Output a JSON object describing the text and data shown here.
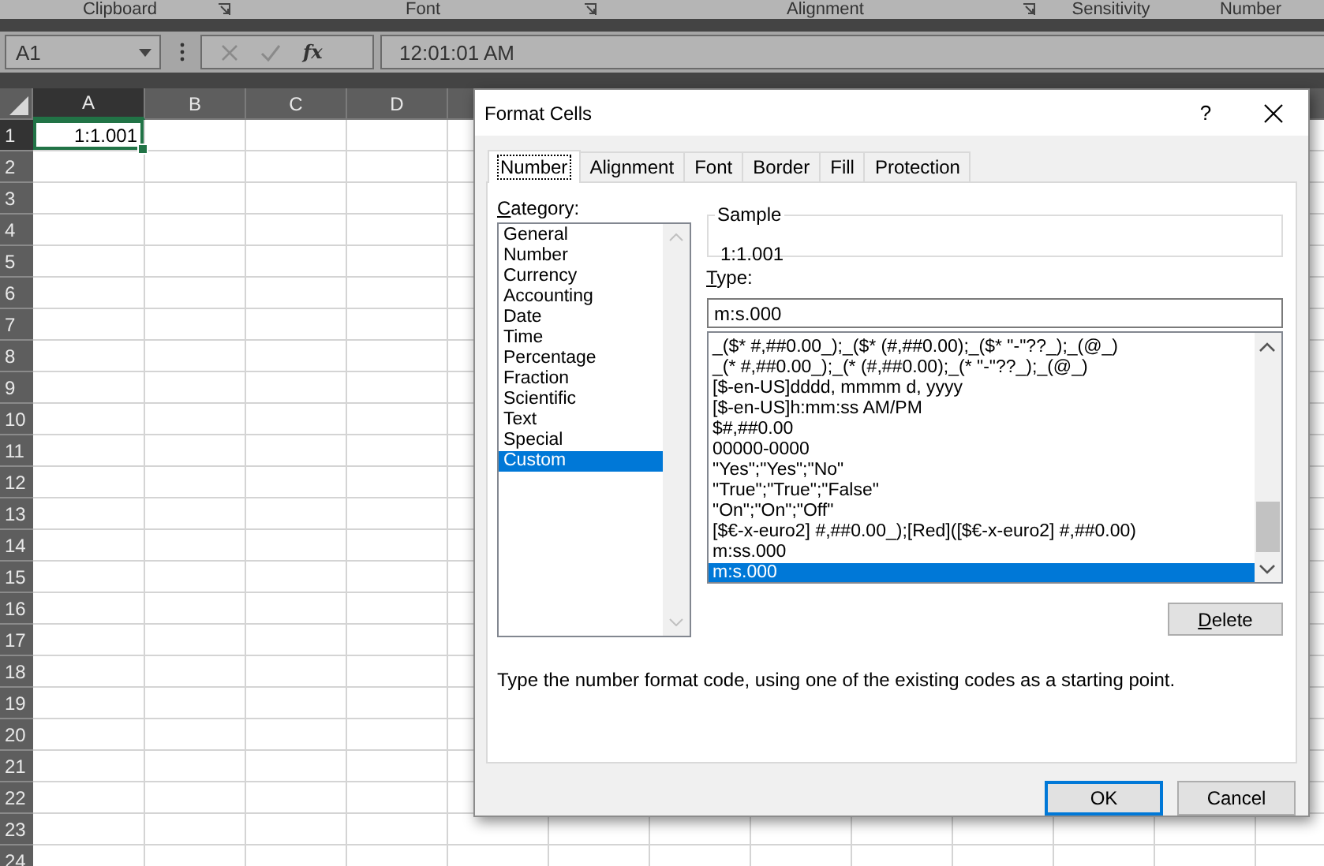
{
  "ribbon": {
    "groups": [
      {
        "label": "Clipboard",
        "launcher": true
      },
      {
        "label": "Font",
        "launcher": true
      },
      {
        "label": "Alignment",
        "launcher": true
      },
      {
        "label": "Sensitivity",
        "launcher": false
      },
      {
        "label": "Number",
        "launcher": false
      }
    ]
  },
  "formula_bar": {
    "name_box": "A1",
    "function_label": "fx",
    "formula": "12:01:01 AM"
  },
  "sheet": {
    "columns": [
      {
        "label": "A",
        "selected": true
      },
      {
        "label": "B",
        "selected": false
      },
      {
        "label": "C",
        "selected": false
      },
      {
        "label": "D",
        "selected": false
      }
    ],
    "rows": [
      {
        "label": "1",
        "selected": true
      },
      {
        "label": "2",
        "selected": false
      },
      {
        "label": "3",
        "selected": false
      },
      {
        "label": "4",
        "selected": false
      },
      {
        "label": "5",
        "selected": false
      },
      {
        "label": "6",
        "selected": false
      },
      {
        "label": "7",
        "selected": false
      },
      {
        "label": "8",
        "selected": false
      },
      {
        "label": "9",
        "selected": false
      },
      {
        "label": "10",
        "selected": false
      },
      {
        "label": "11",
        "selected": false
      },
      {
        "label": "12",
        "selected": false
      },
      {
        "label": "13",
        "selected": false
      },
      {
        "label": "14",
        "selected": false
      },
      {
        "label": "15",
        "selected": false
      },
      {
        "label": "16",
        "selected": false
      },
      {
        "label": "17",
        "selected": false
      },
      {
        "label": "18",
        "selected": false
      },
      {
        "label": "19",
        "selected": false
      },
      {
        "label": "20",
        "selected": false
      },
      {
        "label": "21",
        "selected": false
      },
      {
        "label": "22",
        "selected": false
      },
      {
        "label": "23",
        "selected": false
      },
      {
        "label": "24",
        "selected": false
      }
    ],
    "active_cell_value": "1:1.001"
  },
  "dialog": {
    "title": "Format Cells",
    "help": "?",
    "tabs": [
      {
        "label": "Number",
        "selected": true
      },
      {
        "label": "Alignment",
        "selected": false
      },
      {
        "label": "Font",
        "selected": false
      },
      {
        "label": "Border",
        "selected": false
      },
      {
        "label": "Fill",
        "selected": false
      },
      {
        "label": "Protection",
        "selected": false
      }
    ],
    "category": {
      "label": "Category:",
      "items": [
        {
          "label": "General",
          "selected": false
        },
        {
          "label": "Number",
          "selected": false
        },
        {
          "label": "Currency",
          "selected": false
        },
        {
          "label": "Accounting",
          "selected": false
        },
        {
          "label": "Date",
          "selected": false
        },
        {
          "label": "Time",
          "selected": false
        },
        {
          "label": "Percentage",
          "selected": false
        },
        {
          "label": "Fraction",
          "selected": false
        },
        {
          "label": "Scientific",
          "selected": false
        },
        {
          "label": "Text",
          "selected": false
        },
        {
          "label": "Special",
          "selected": false
        },
        {
          "label": "Custom",
          "selected": true
        }
      ]
    },
    "sample": {
      "label": "Sample",
      "value": "1:1.001"
    },
    "type": {
      "label": "Type:",
      "value": "m:s.000",
      "items": [
        {
          "label": "_($* #,##0.00_);_($* (#,##0.00);_($* \"-\"??_);_(@_)",
          "selected": false
        },
        {
          "label": "_(* #,##0.00_);_(* (#,##0.00);_(* \"-\"??_);_(@_)",
          "selected": false
        },
        {
          "label": "[$-en-US]dddd, mmmm d, yyyy",
          "selected": false
        },
        {
          "label": "[$-en-US]h:mm:ss AM/PM",
          "selected": false
        },
        {
          "label": "$#,##0.00",
          "selected": false
        },
        {
          "label": "00000-0000",
          "selected": false
        },
        {
          "label": "\"Yes\";\"Yes\";\"No\"",
          "selected": false
        },
        {
          "label": "\"True\";\"True\";\"False\"",
          "selected": false
        },
        {
          "label": "\"On\";\"On\";\"Off\"",
          "selected": false
        },
        {
          "label": "[$€-x-euro2] #,##0.00_);[Red]([$€-x-euro2] #,##0.00)",
          "selected": false
        },
        {
          "label": "m:ss.000",
          "selected": false
        },
        {
          "label": "m:s.000",
          "selected": true
        }
      ]
    },
    "delete_button": "Delete",
    "hint": "Type the number format code, using one of the existing codes as a starting point.",
    "buttons": [
      {
        "label": "OK",
        "kind": "default"
      },
      {
        "label": "Cancel",
        "kind": "normal"
      }
    ]
  }
}
